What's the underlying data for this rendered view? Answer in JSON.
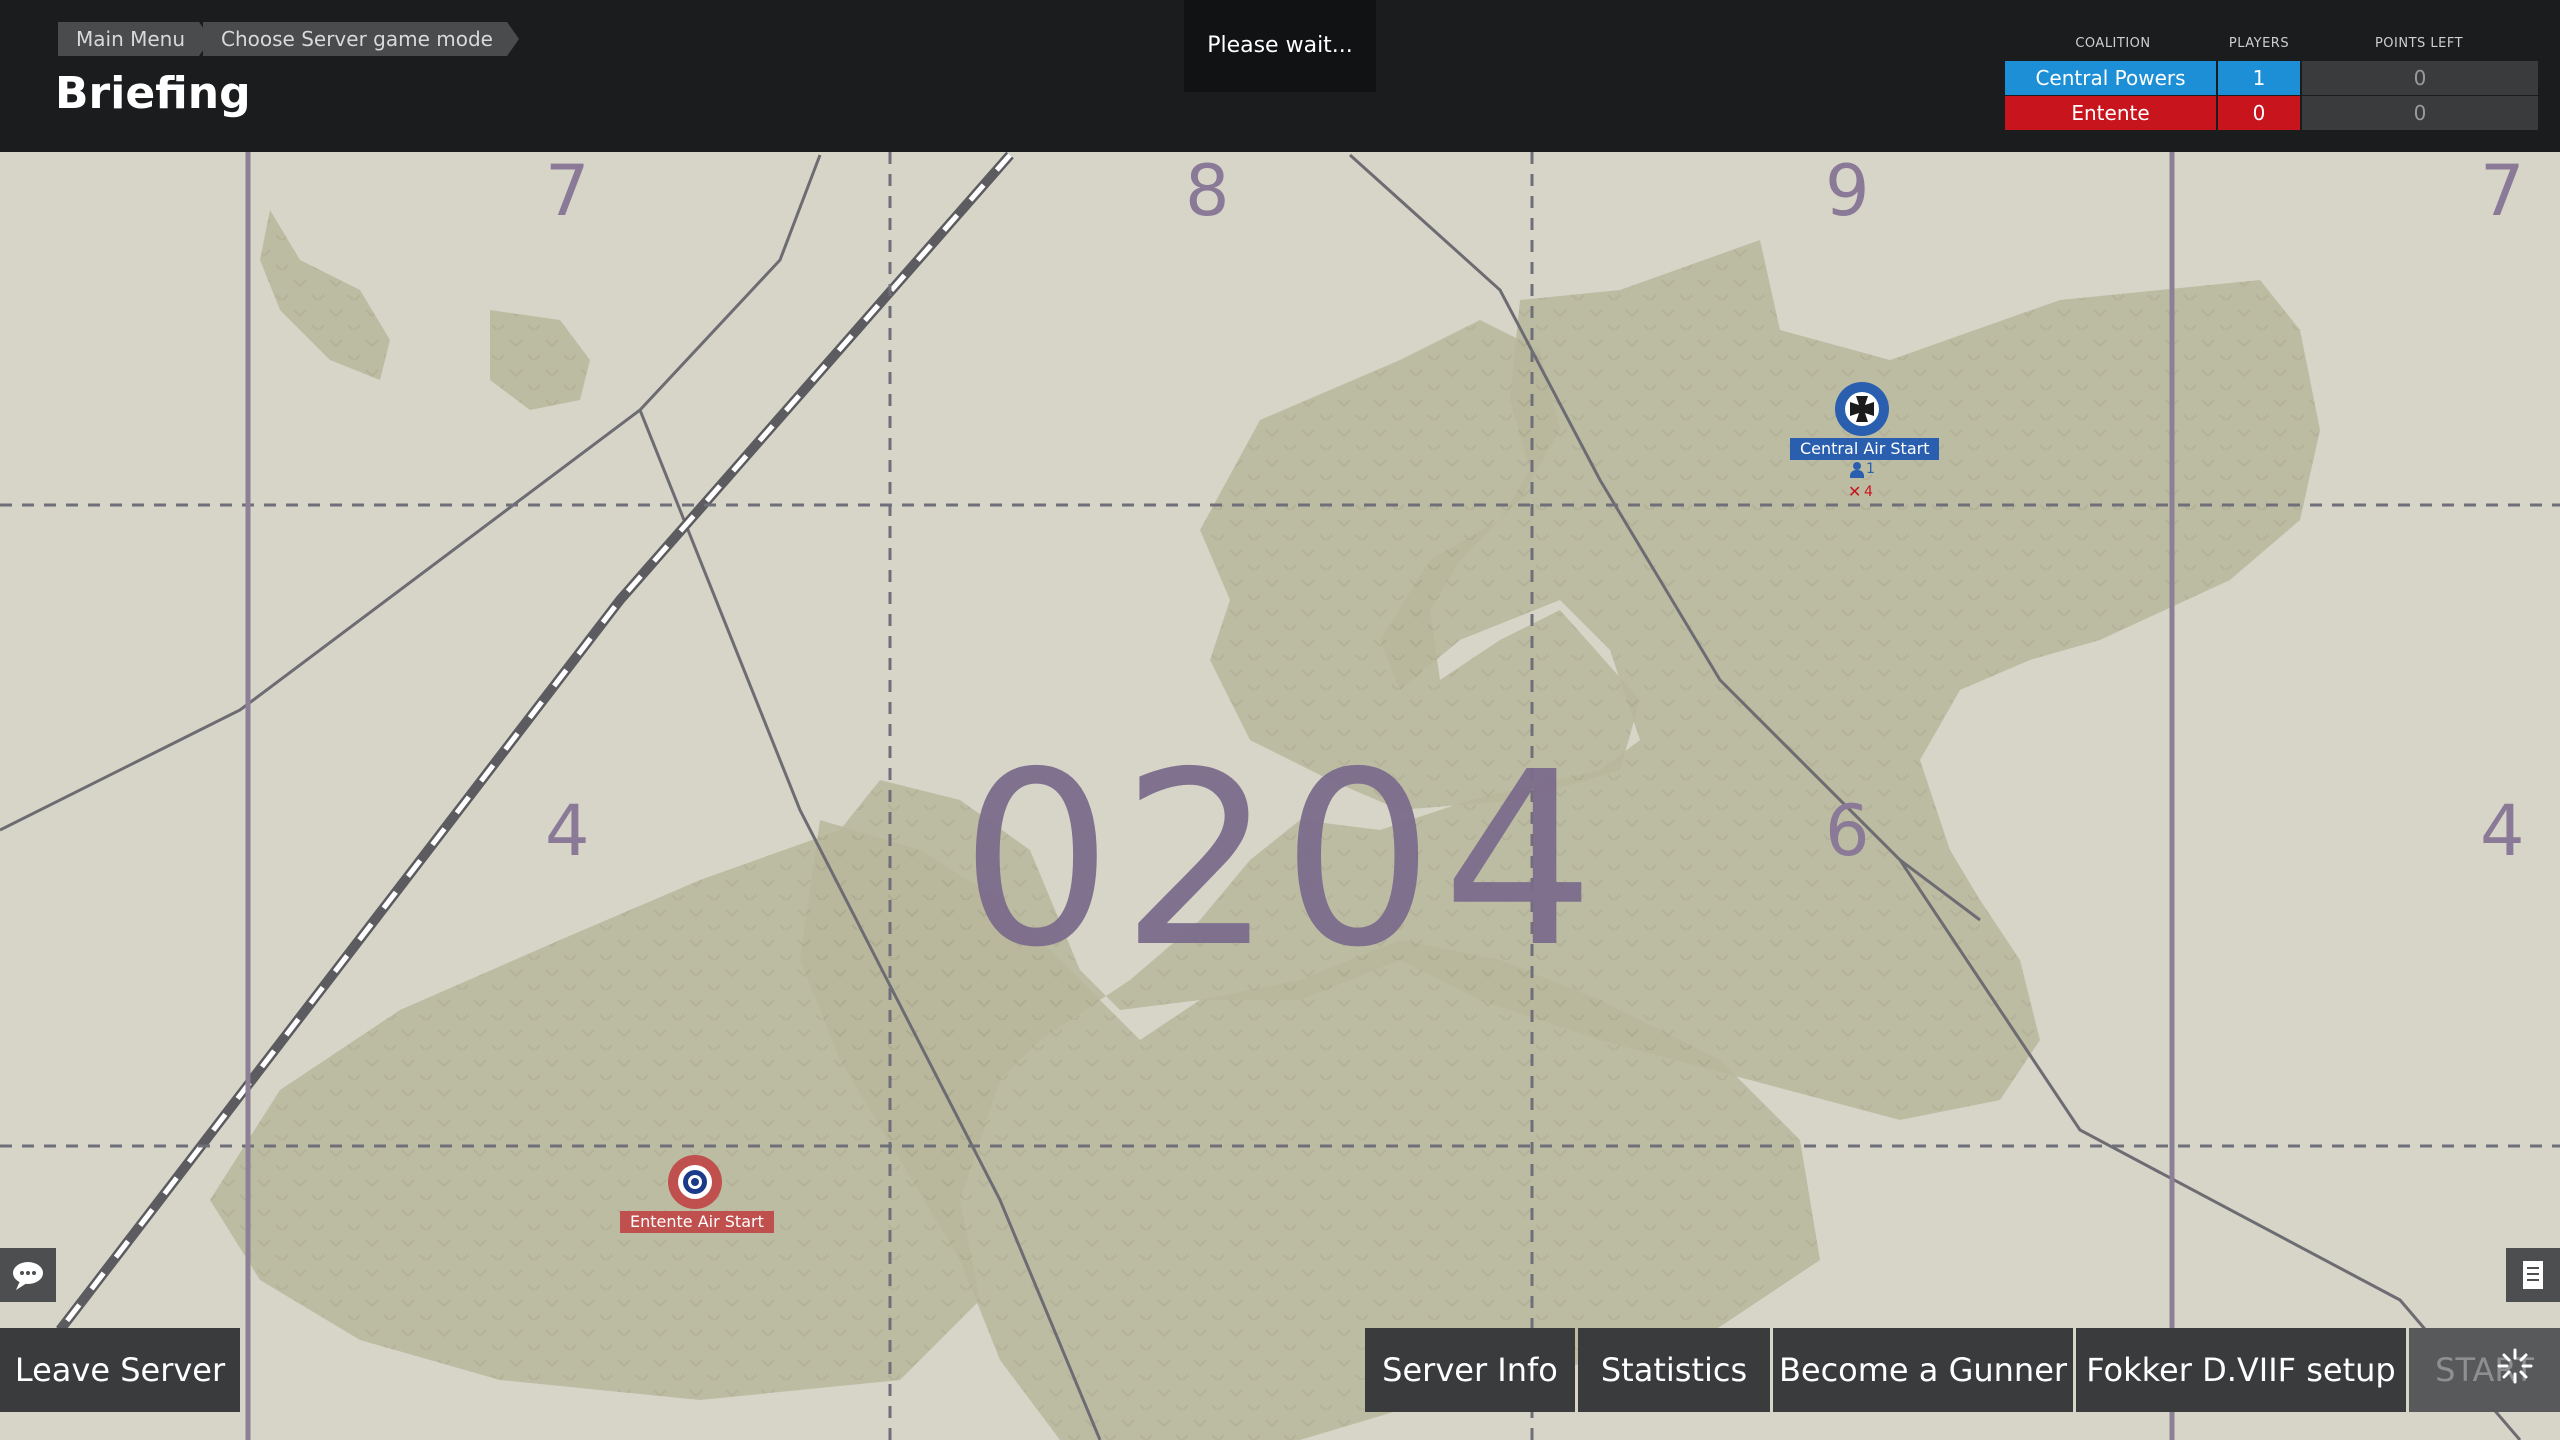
{
  "breadcrumb": {
    "items": [
      "Main Menu",
      "Choose Server game mode"
    ]
  },
  "header": {
    "title": "Briefing",
    "status": "Please wait..."
  },
  "scoreboard": {
    "headers": {
      "coalition": "COALITION",
      "players": "PLAYERS",
      "points_left": "POINTS LEFT"
    },
    "rows": [
      {
        "coalition": "Central Powers",
        "players": "1",
        "points_left": "0",
        "color": "#1c8fd6"
      },
      {
        "coalition": "Entente",
        "players": "0",
        "points_left": "0",
        "color": "#c8141c"
      }
    ]
  },
  "map": {
    "grid_numbers": {
      "top": [
        "7",
        "8",
        "9",
        "7"
      ],
      "middle": [
        "4",
        "6",
        "4"
      ]
    },
    "sector": "0204",
    "colors": {
      "land": "#d6d5c8",
      "forest": "#b8b79c",
      "grid": "#6f6f7a",
      "sector_text": "#7c6c8c"
    },
    "markers": {
      "central": {
        "label": "Central Air Start",
        "players": "1",
        "planes": "4",
        "icon": "iron-cross-icon",
        "color": "#2a5fb0"
      },
      "entente": {
        "label": "Entente Air Start",
        "icon": "roundel-icon",
        "color": "#c0504d"
      }
    }
  },
  "buttons": {
    "leave": "Leave Server",
    "server_info": "Server Info",
    "statistics": "Statistics",
    "gunner": "Become a Gunner",
    "setup": "Fokker D.VIIF setup",
    "start": "START"
  }
}
